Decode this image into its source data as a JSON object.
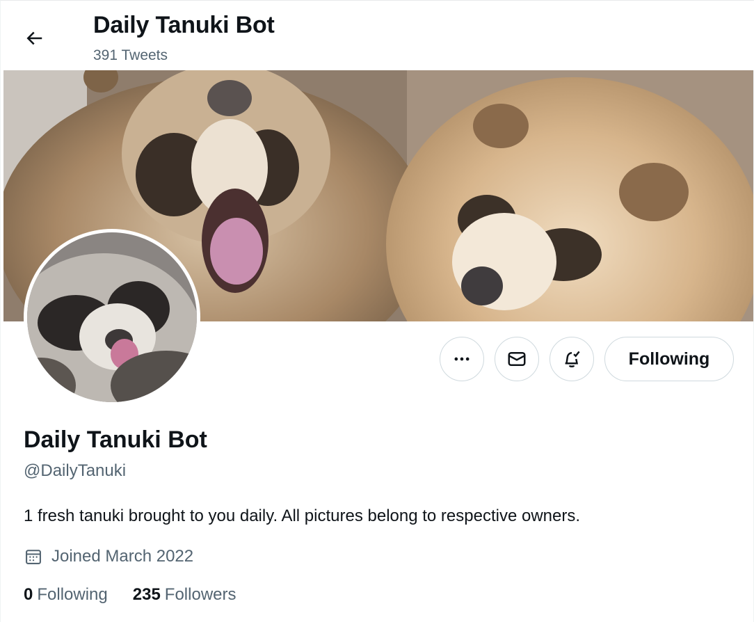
{
  "header": {
    "title": "Daily Tanuki Bot",
    "tweet_count": "391 Tweets"
  },
  "actions": {
    "following_label": "Following"
  },
  "profile": {
    "display_name": "Daily Tanuki Bot",
    "handle": "@DailyTanuki",
    "bio": "1 fresh tanuki brought to you daily. All pictures belong to respective owners.",
    "joined": "Joined March 2022",
    "following_count": "0",
    "following_label": "Following",
    "followers_count": "235",
    "followers_label": "Followers"
  },
  "icons": {
    "back": "arrow-left-icon",
    "more": "more-horizontal-icon",
    "message": "envelope-icon",
    "notify": "bell-check-icon",
    "calendar": "calendar-icon"
  },
  "colors": {
    "text_primary": "#0f1419",
    "text_secondary": "#536471",
    "border": "#cfd9de"
  }
}
